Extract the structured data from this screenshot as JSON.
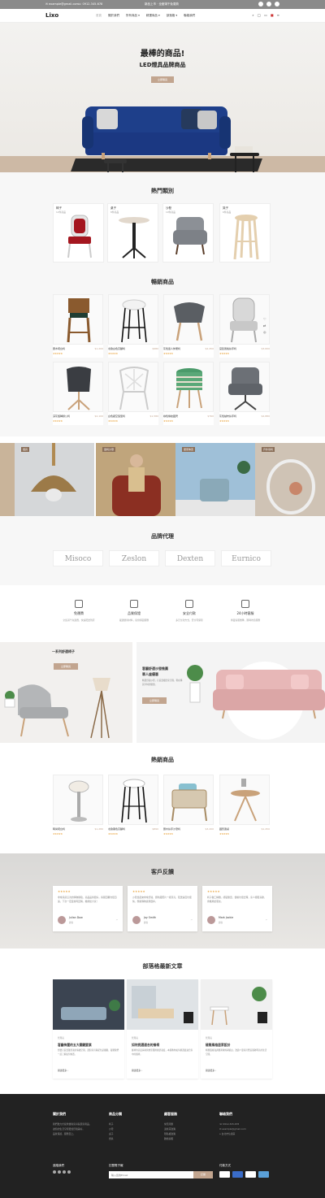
{
  "topbar": {
    "email": "✉ example@gmail.com",
    "phone": "☏ 0912-345-678",
    "notice": "新品上市 · 全館滿千免運費",
    "social": [
      "facebook-icon",
      "twitter-icon",
      "instagram-icon"
    ]
  },
  "nav": {
    "logo": "Lixo",
    "menu": [
      "首頁",
      "關於我們",
      "所有商品 ▾",
      "精選商品 ▾",
      "部落格 ▾",
      "聯絡我們"
    ],
    "icons": {
      "search": "⌕",
      "user": "👤",
      "cart": "🛒",
      "flag": "▪",
      "menu": "≡"
    }
  },
  "hero": {
    "title": "最棒的商品!",
    "subtitle": "LED燈具品牌商品",
    "button": "立即購買"
  },
  "categories": {
    "title": "熱門類別",
    "items": [
      {
        "label": "椅子",
        "sub": "12件商品"
      },
      {
        "label": "桌子",
        "sub": "8件商品"
      },
      {
        "label": "沙發",
        "sub": "10件商品"
      },
      {
        "label": "凳子",
        "sub": "6件商品"
      }
    ]
  },
  "bestseller": {
    "title": "暢銷商品",
    "items": [
      {
        "name": "實木吧台椅",
        "price": "$1,200",
        "stars": "★★★★★"
      },
      {
        "name": "北歐白色高腳椅",
        "price": "$980",
        "stars": "★★★★★"
      },
      {
        "name": "灰色單人休閒椅",
        "price": "$2,450",
        "stars": "★★★★★"
      },
      {
        "name": "宮廷風格扶手椅",
        "price": "$3,600",
        "stars": "★★★★★"
      },
      {
        "name": "深灰旋轉辦公椅",
        "price": "$2,100",
        "stars": "★★★★★"
      },
      {
        "name": "白色鏤空造型椅",
        "price": "$1,580",
        "stars": "★★★★★"
      },
      {
        "name": "綠色條紋圓凳",
        "price": "$760",
        "stars": "★★★★★"
      },
      {
        "name": "灰色絨布扶手椅",
        "price": "$2,880",
        "stars": "★★★★★"
      }
    ]
  },
  "banners": [
    "燈具",
    "單椅沙發",
    "居家佈置",
    "戶外吊椅"
  ],
  "brands": {
    "title": "品牌代理",
    "items": [
      "Misoco",
      "Zeslon",
      "Dexten",
      "Eurnico"
    ]
  },
  "features": [
    {
      "title": "免運費",
      "desc": "全館滿千免運費，快速配送到府"
    },
    {
      "title": "品質保證",
      "desc": "嚴選優質材料，提供保固服務"
    },
    {
      "title": "安全付款",
      "desc": "多元付款方式，安全有保障"
    },
    {
      "title": "24小時客服",
      "desc": "專業客服團隊，隨時為您服務"
    }
  ],
  "promos": [
    {
      "title": "一系列舒適椅子",
      "button": "立即購買"
    },
    {
      "title": "客廳舒適沙發推薦",
      "title2": "單人座優惠",
      "desc": "精選舒適沙發，打造溫暖居家空間，現在購買享特別優惠。",
      "button": "立即購買"
    }
  ],
  "newproducts": {
    "title": "熱銷商品",
    "items": [
      {
        "name": "時尚吧台椅",
        "price": "$1,280",
        "stars": "★★★★★"
      },
      {
        "name": "北歐黑色高腳椅",
        "price": "$890",
        "stars": "★★★★★"
      },
      {
        "name": "實木扶手沙發椅",
        "price": "$3,200",
        "stars": "★★★★★"
      },
      {
        "name": "圓形邊桌",
        "price": "$1,450",
        "stars": "★★★★★"
      }
    ]
  },
  "reviews": {
    "title": "客戶反饋",
    "items": [
      {
        "stars": "★★★★★",
        "text": "非常滿意這次的購物體驗，商品品質很好，客服回覆也很迅速，下次一定還會再回購。推薦給大家！",
        "name": "Julian Dow",
        "role": "顧客"
      },
      {
        "stars": "★★★★★",
        "text": "沙發坐起來非常舒適，顏色跟照片一樣漂亮，配送速度也很快，整體購物感覺很棒。",
        "name": "Jay Smith",
        "role": "顧客"
      },
      {
        "stars": "★★★★★",
        "text": "椅子做工精緻，組裝簡單，價格也很合理，家人都很喜歡，會推薦給朋友。",
        "name": "Mark Jackie",
        "role": "顧客"
      }
    ]
  },
  "blog": {
    "title": "部落格最新文章",
    "items": [
      {
        "meta": "管理員",
        "title": "客廳佈置的五大關鍵要素",
        "excerpt": "想要打造溫馨舒適的客廳空間，選對家具與配色是關鍵，跟著我們一起了解如何佈置。",
        "more": "閱讀更多 ›"
      },
      {
        "meta": "管理員",
        "title": "如何挑選適合的餐椅",
        "excerpt": "餐椅的高度與材質會影響用餐舒適度，本篇教你如何挑選最適合家中的餐椅。",
        "more": "閱讀更多 ›"
      },
      {
        "meta": "管理員",
        "title": "極簡風格居家設計",
        "excerpt": "極簡風格強調簡潔線條與留白，透過少量家具營造寬敞明亮的生活空間。",
        "more": "閱讀更多 ›"
      }
    ]
  },
  "footer": {
    "cols": [
      {
        "title": "關於我們",
        "text": [
          "我們致力於提供優質家具與居家用品，",
          "讓您的生活空間更加舒適美好，",
          "品質保證，服務至上。"
        ]
      },
      {
        "title": "商品分類",
        "text": [
          "椅子",
          "沙發",
          "桌子",
          "燈具"
        ]
      },
      {
        "title": "顧客服務",
        "text": [
          "常見問題",
          "退換貨政策",
          "隱私權政策",
          "聯絡客服"
        ]
      },
      {
        "title": "聯絡我們",
        "text": [
          "☏ 0912-345-678",
          "✉ example@gmail.com",
          "⌂ 台北市信義區"
        ]
      }
    ],
    "follow": "追蹤我們",
    "subscribe": "訂閱電子報",
    "subscribe_placeholder": "輸入您的Email",
    "subscribe_btn": "訂閱",
    "payment": "付款方式"
  },
  "colors": {
    "accent": "#c2a58f",
    "sofa": "#1e3f8a",
    "footer": "#222222"
  }
}
